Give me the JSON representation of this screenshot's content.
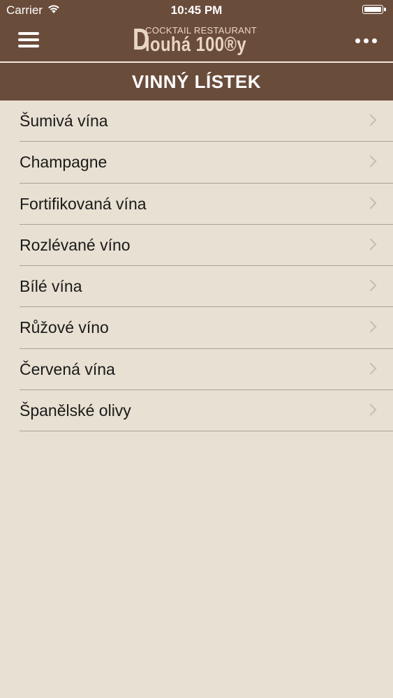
{
  "status_bar": {
    "carrier": "Carrier",
    "time": "10:45 PM"
  },
  "nav": {
    "logo_letter": "D",
    "logo_subtitle": "COCKTAIL RESTAURANT",
    "logo_name": "louhá 100®y",
    "menu_icon": "hamburger-icon",
    "more_icon": "ellipsis-icon"
  },
  "section": {
    "title": "VINNÝ LÍSTEK"
  },
  "items": [
    {
      "label": "Šumivá vína"
    },
    {
      "label": "Champagne"
    },
    {
      "label": "Fortifikovaná vína"
    },
    {
      "label": "Rozlévané víno"
    },
    {
      "label": "Bílé vína"
    },
    {
      "label": "Růžové víno"
    },
    {
      "label": "Červená vína"
    },
    {
      "label": "Španělské olivy"
    }
  ],
  "colors": {
    "header_brown": "#6a4c3b",
    "background": "#e8e0d2",
    "logo": "#e8d6c0"
  }
}
